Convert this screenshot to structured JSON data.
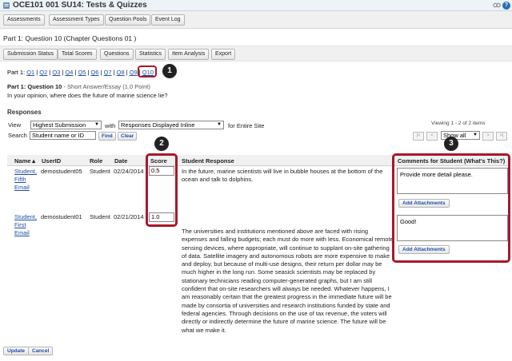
{
  "window": {
    "title": "OCE101 001 SU14: Tests & Quizzes",
    "help_symbol": "?"
  },
  "navbar": {
    "items": [
      "Assessments",
      "Assessment Types",
      "Question Pools",
      "Event Log"
    ]
  },
  "page": {
    "heading": "Part 1: Question 10",
    "heading_suffix": "(Chapter Questions 01 )"
  },
  "subnav": {
    "items": [
      "Submission Status",
      "Total Scores",
      "Questions",
      "Statistics",
      "Item Analysis",
      "Export"
    ]
  },
  "parts": {
    "label": "Part 1:",
    "links": [
      "Q1",
      "Q2",
      "Q3",
      "Q4",
      "Q5",
      "Q6",
      "Q7",
      "Q8",
      "Q9"
    ],
    "current": "Q10",
    "separator": "|"
  },
  "question": {
    "title": "Part 1: Question 10",
    "type": " - Short Answer/Essay (1.0 Point)",
    "text": "In your opinion, where does the future of marine science lie?"
  },
  "responses": {
    "heading": "Responses",
    "view_label": "View",
    "view_select": "Highest Submission",
    "with_label": "with",
    "display_select": "Responses Displayed Inline",
    "scope_text": "for Entire Site",
    "search_label": "Search",
    "search_value": "Student name or ID",
    "find_label": "Find",
    "clear_label": "Clear",
    "viewing_text": "Viewing 1 - 2 of 2 items",
    "pager": {
      "first": "|<",
      "prev": "<",
      "show": "Show all",
      "next": ">",
      "last": ">|"
    }
  },
  "table": {
    "headers": {
      "name": "Name▲",
      "userid": "UserID",
      "role": "Role",
      "date": "Date",
      "score": "Score",
      "response": "Student Response",
      "comments": "Comments for Student",
      "whats_this": "(What's This?)"
    },
    "rows": [
      {
        "name_lines": [
          "Student,",
          "Fifth",
          "Email"
        ],
        "userid": "demostudent05",
        "role": "Student",
        "date": "02/24/2014",
        "score": "0.5",
        "response": "In the future, marine scientists will live in bubble houses at the bottom of the ocean and talk to dolphins.",
        "comment": "Provide more detail please.",
        "attach_label": "Add Attachments"
      },
      {
        "name_lines": [
          "Student,",
          "First",
          "Email"
        ],
        "userid": "demostudent01",
        "role": "Student",
        "date": "02/21/2014",
        "score": "1.0",
        "response": "The universities and institutions mentioned above are faced with rising expenses and falling budgets; each must do more with less. Economical remote sensing devices, where appropriate, will continue to supplant on-site gathering of data. Satellite imagery and autonomous robots are more expensive to make and deploy, but because of multi-use designs, their return per dollar may be much higher in the long run. Some seasick scientists may be replaced by stationary technicians reading computer-generated graphs, but I am still confident that on-site researchers will always be needed. Whatever happens, I am reasonably certain that the greatest progress in the immediate future will be made by consortia of universities and research institutions funded by state and federal agencies. Through decisions on the use of tax revenue, the voters will directly or indirectly determine the future of marine science. The future will be what we make it.",
        "comment": "Good!",
        "attach_label": "Add Attachments"
      }
    ]
  },
  "footer": {
    "update_label": "Update",
    "cancel_label": "Cancel"
  },
  "callouts": [
    "1",
    "2",
    "3"
  ],
  "colors": {
    "highlight": "#a8182b",
    "link": "#1f4ea8",
    "callout": "#222222"
  }
}
